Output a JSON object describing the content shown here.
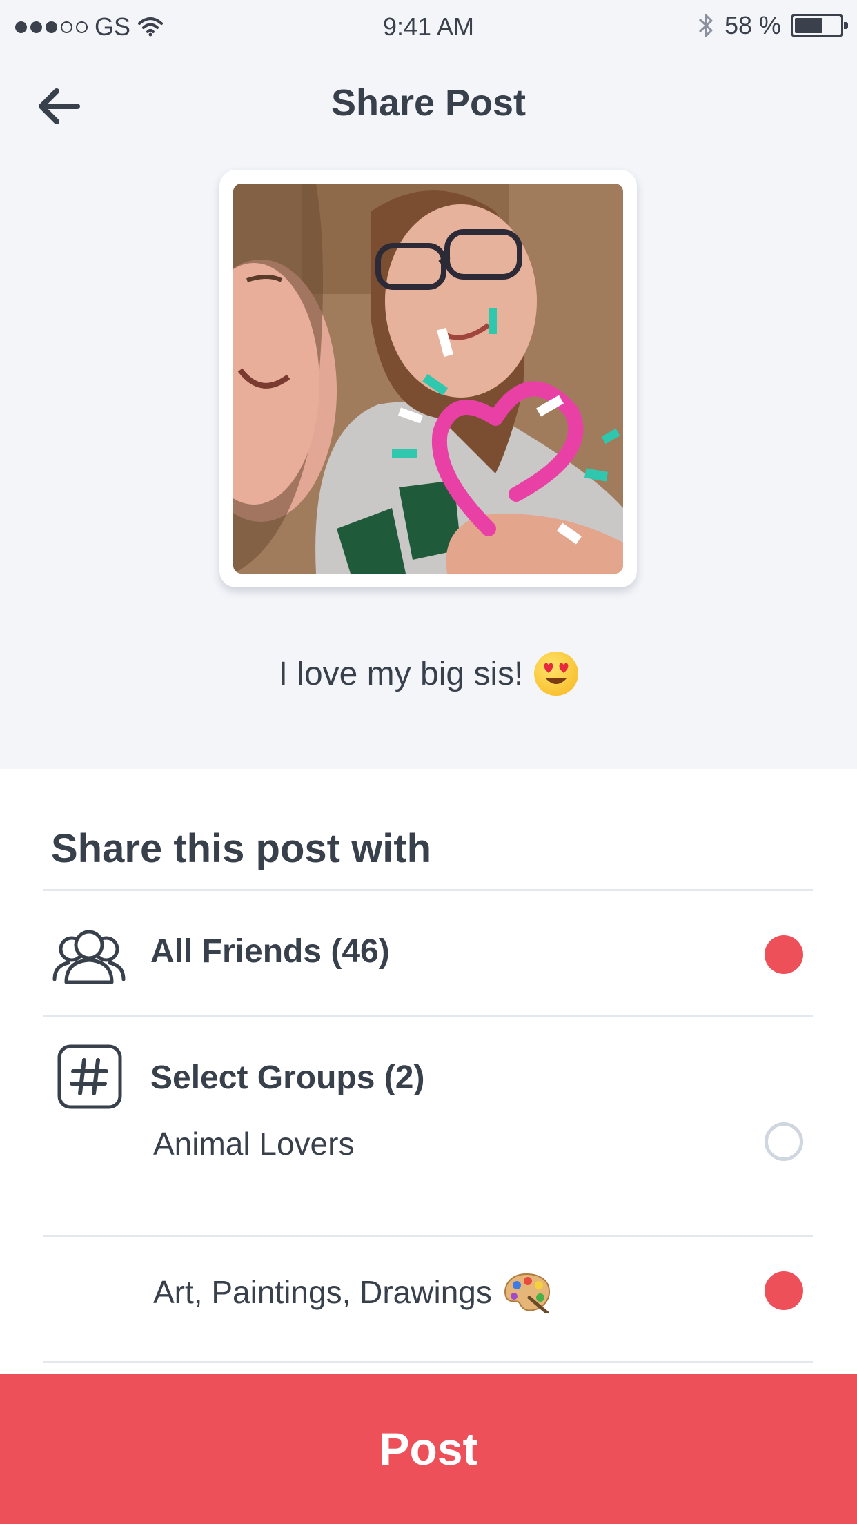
{
  "status_bar": {
    "carrier": "GS",
    "time": "9:41 AM",
    "battery_percent": "58 %"
  },
  "header": {
    "title": "Share Post",
    "back_icon": "arrow-left-icon"
  },
  "post": {
    "caption": "I love my big sis!",
    "caption_emoji": "heart-eyes-emoji"
  },
  "share": {
    "title": "Share this post with",
    "all_friends": {
      "label": "All Friends (46)",
      "icon": "friends-group-icon",
      "selected": true
    },
    "groups": {
      "label": "Select Groups (2)",
      "icon": "hashtag-icon",
      "items": [
        {
          "label": "Animal Lovers",
          "selected": false
        },
        {
          "label": "Art, Paintings, Drawings",
          "emoji": "artist-palette-emoji",
          "selected": true
        }
      ]
    }
  },
  "post_button": {
    "label": "Post"
  },
  "colors": {
    "accent": "#ee5059",
    "text": "#38404c",
    "background": "#f3f5f9",
    "divider": "#e3e8ee"
  }
}
